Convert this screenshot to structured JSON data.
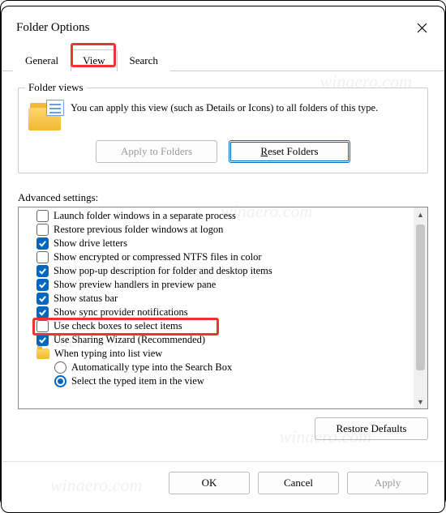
{
  "window": {
    "title": "Folder Options"
  },
  "tabs": {
    "general": "General",
    "view": "View",
    "search": "Search",
    "active": "view"
  },
  "folder_views": {
    "group_label": "Folder views",
    "description": "You can apply this view (such as Details or Icons) to all folders of this type.",
    "apply_btn": "Apply to Folders",
    "reset_btn_pre": "",
    "reset_btn_mn": "R",
    "reset_btn_post": "eset Folders"
  },
  "advanced": {
    "label": "Advanced settings:",
    "items": [
      {
        "type": "check",
        "checked": false,
        "label": "Launch folder windows in a separate process"
      },
      {
        "type": "check",
        "checked": false,
        "label": "Restore previous folder windows at logon"
      },
      {
        "type": "check",
        "checked": true,
        "label": "Show drive letters"
      },
      {
        "type": "check",
        "checked": false,
        "label": "Show encrypted or compressed NTFS files in color"
      },
      {
        "type": "check",
        "checked": true,
        "label": "Show pop-up description for folder and desktop items"
      },
      {
        "type": "check",
        "checked": true,
        "label": "Show preview handlers in preview pane"
      },
      {
        "type": "check",
        "checked": true,
        "label": "Show status bar"
      },
      {
        "type": "check",
        "checked": true,
        "label": "Show sync provider notifications"
      },
      {
        "type": "check",
        "checked": false,
        "label": "Use check boxes to select items",
        "highlight": true
      },
      {
        "type": "check",
        "checked": true,
        "label": "Use Sharing Wizard (Recommended)"
      },
      {
        "type": "folder",
        "label": "When typing into list view"
      },
      {
        "type": "radio",
        "checked": false,
        "indent": true,
        "label": "Automatically type into the Search Box"
      },
      {
        "type": "radio",
        "checked": true,
        "indent": true,
        "label": "Select the typed item in the view"
      }
    ],
    "restore_btn": "Restore Defaults"
  },
  "dialog_buttons": {
    "ok": "OK",
    "cancel": "Cancel",
    "apply": "Apply"
  },
  "colors": {
    "accent": "#0067c0",
    "highlight": "#e33"
  },
  "watermark": "winaero.com"
}
